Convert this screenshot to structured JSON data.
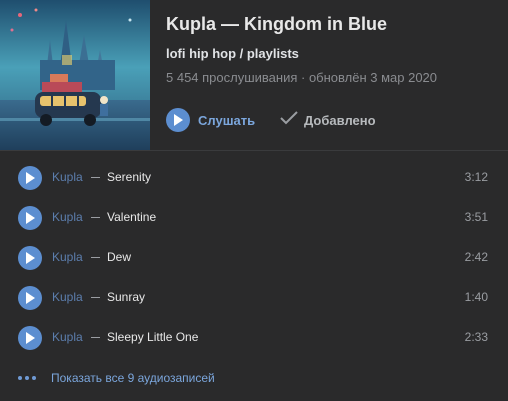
{
  "playlist": {
    "title": "Kupla — Kingdom in Blue",
    "genre": "lofi hip hop / playlists",
    "meta": "5 454 прослушивания · обновлён 3 мар 2020",
    "listen_label": "Слушать",
    "added_label": "Добавлено"
  },
  "tracks": [
    {
      "artist": "Kupla",
      "name": "Serenity",
      "duration": "3:12"
    },
    {
      "artist": "Kupla",
      "name": "Valentine",
      "duration": "3:51"
    },
    {
      "artist": "Kupla",
      "name": "Dew",
      "duration": "2:42"
    },
    {
      "artist": "Kupla",
      "name": "Sunray",
      "duration": "1:40"
    },
    {
      "artist": "Kupla",
      "name": "Sleepy Little One",
      "duration": "2:33"
    }
  ],
  "show_all_label": "Показать все 9 аудиозаписей",
  "colors": {
    "background": "#2a2a2b",
    "accent": "#5c8ed0",
    "link": "#7ba6dc"
  }
}
